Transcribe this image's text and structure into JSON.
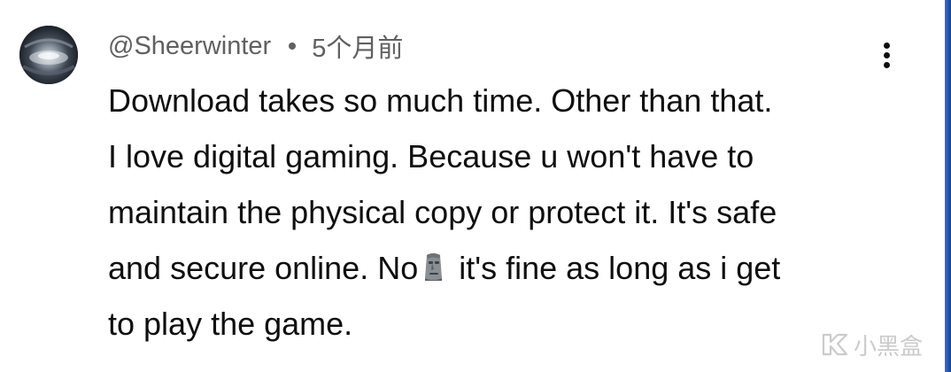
{
  "comment": {
    "username": "@Sheerwinter",
    "separator": "•",
    "timestamp": "5个月前",
    "lines": [
      "Download takes so much time. Other than that.",
      "I love digital gaming. Because u won't have to",
      "maintain the physical copy or protect it. It's safe",
      "and secure online. No",
      "to play the game."
    ],
    "line4_after_emoji": "it's fine as long as i get",
    "emoji": "moai-emoji",
    "menu_icon": "more-vertical-icon"
  },
  "watermark": {
    "text": "小黑盒",
    "icon": "xiaoheihe-logo-icon"
  },
  "colors": {
    "text": "#0f0f0f",
    "meta": "#606060",
    "edge_accent": "#3a6ed8"
  }
}
